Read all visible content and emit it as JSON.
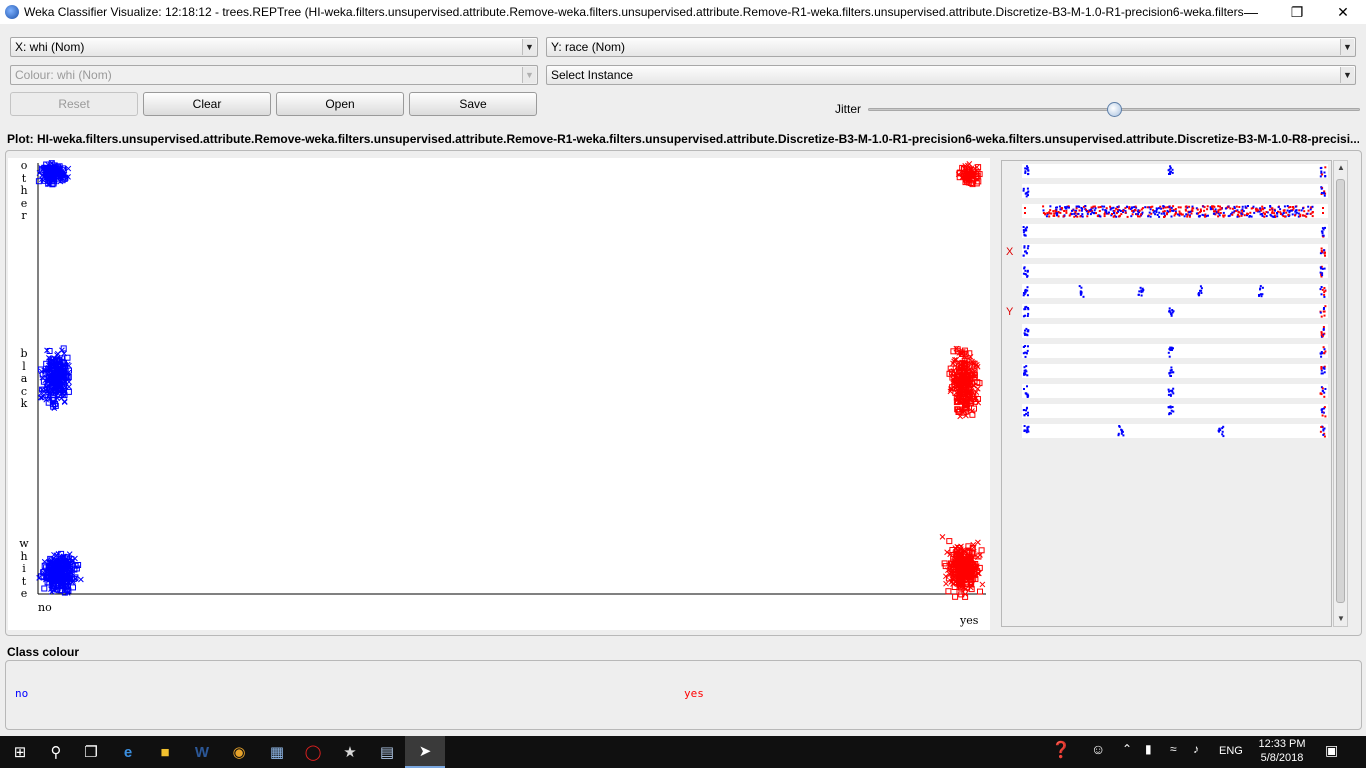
{
  "window": {
    "title": "Weka Classifier Visualize: 12:18:12 - trees.REPTree (HI-weka.filters.unsupervised.attribute.Remove-weka.filters.unsupervised.attribute.Remove-R1-weka.filters.unsupervised.attribute.Discretize-B3-M-1.0-R1-precision6-weka.filters....",
    "minimize": "—",
    "restore": "❐",
    "close": "✕"
  },
  "controls": {
    "x_axis": "X: whi (Nom)",
    "y_axis": "Y: race (Nom)",
    "colour": "Colour: whi (Nom)",
    "select_instance": "Select Instance",
    "reset": "Reset",
    "clear": "Clear",
    "open": "Open",
    "save": "Save",
    "jitter_label": "Jitter",
    "jitter_fraction": 0.5
  },
  "plot": {
    "label": "Plot: HI-weka.filters.unsupervised.attribute.Remove-weka.filters.unsupervised.attribute.Remove-R1-weka.filters.unsupervised.attribute.Discretize-B3-M-1.0-R1-precision6-weka.filters.unsupervised.attribute.Discretize-B3-M-1.0-R8-precisi...",
    "x_ticks": [
      "no",
      "yes"
    ],
    "y_ticks": [
      "other",
      "black",
      "white"
    ],
    "class_colors": {
      "no": "#0000ff",
      "yes": "#ff0000"
    }
  },
  "attr_panel": {
    "x_marker": "X",
    "y_marker": "Y"
  },
  "class_colour": {
    "label": "Class colour",
    "items": [
      {
        "name": "no",
        "color": "#0000ff"
      },
      {
        "name": "yes",
        "color": "#ff0000"
      }
    ]
  },
  "taskbar": {
    "language": "ENG",
    "time": "12:33 PM",
    "date": "5/8/2018",
    "icons": [
      "windows-icon",
      "search-icon",
      "task-view-icon",
      "edge-icon",
      "file-explorer-icon",
      "word-icon",
      "chrome-icon",
      "notes-icon",
      "opera-icon",
      "paint-icon",
      "notepad-icon",
      "weka-icon"
    ]
  }
}
